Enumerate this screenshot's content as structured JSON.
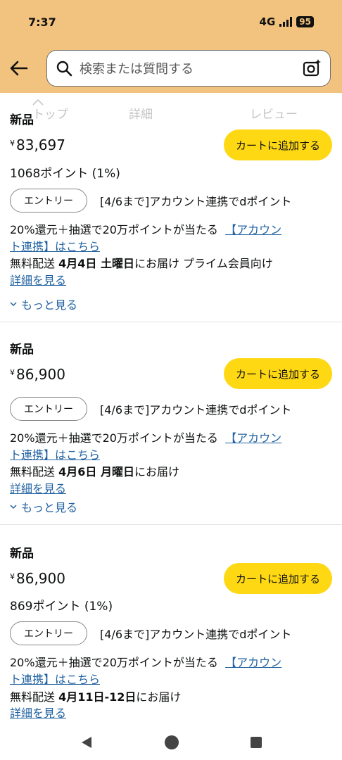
{
  "status_bar": {
    "time": "7:37",
    "network": "4G",
    "battery": "95"
  },
  "header": {
    "search_placeholder": "検索または質問する"
  },
  "tabs": {
    "items": [
      {
        "label": "トップ"
      },
      {
        "label": "詳細"
      },
      {
        "label": "レビュー"
      }
    ]
  },
  "offers": [
    {
      "condition": "新品",
      "currency": "¥",
      "price": "83,697",
      "cart_label": "カートに追加する",
      "points": "1068ポイント (1%)",
      "entry_label": "エントリー",
      "promo_inline": "[4/6まで]アカウント連携でdポイント",
      "promo_text": "20%還元＋抽選で20万ポイントが当たる",
      "promo_link_a": "【アカウン",
      "promo_link_b": "ト連携】はこちら",
      "delivery_prefix": "無料配送",
      "delivery_date": "4月4日 土曜日",
      "delivery_suffix": "にお届け プライム会員向け",
      "details_link": "詳細を見る",
      "more_label": "もっと見る"
    },
    {
      "condition": "新品",
      "currency": "¥",
      "price": "86,900",
      "cart_label": "カートに追加する",
      "entry_label": "エントリー",
      "promo_inline": "[4/6まで]アカウント連携でdポイント",
      "promo_text": "20%還元＋抽選で20万ポイントが当たる",
      "promo_link_a": "【アカウン",
      "promo_link_b": "ト連携】はこちら",
      "delivery_prefix": "無料配送",
      "delivery_date": "4月6日 月曜日",
      "delivery_suffix": "にお届け",
      "details_link": "詳細を見る",
      "more_label": "もっと見る"
    },
    {
      "condition": "新品",
      "currency": "¥",
      "price": "86,900",
      "cart_label": "カートに追加する",
      "points": "869ポイント (1%)",
      "entry_label": "エントリー",
      "promo_inline": "[4/6まで]アカウント連携でdポイント",
      "promo_text": "20%還元＋抽選で20万ポイントが当たる",
      "promo_link_a": "【アカウン",
      "promo_link_b": "ト連携】はこちら",
      "delivery_prefix": "無料配送",
      "delivery_date": "4月11日-12日",
      "delivery_suffix": "にお届け",
      "details_link": "詳細を見る"
    }
  ],
  "colors": {
    "header_bg": "#f2c27f",
    "cart_button": "#ffd814",
    "link": "#2162a1"
  }
}
